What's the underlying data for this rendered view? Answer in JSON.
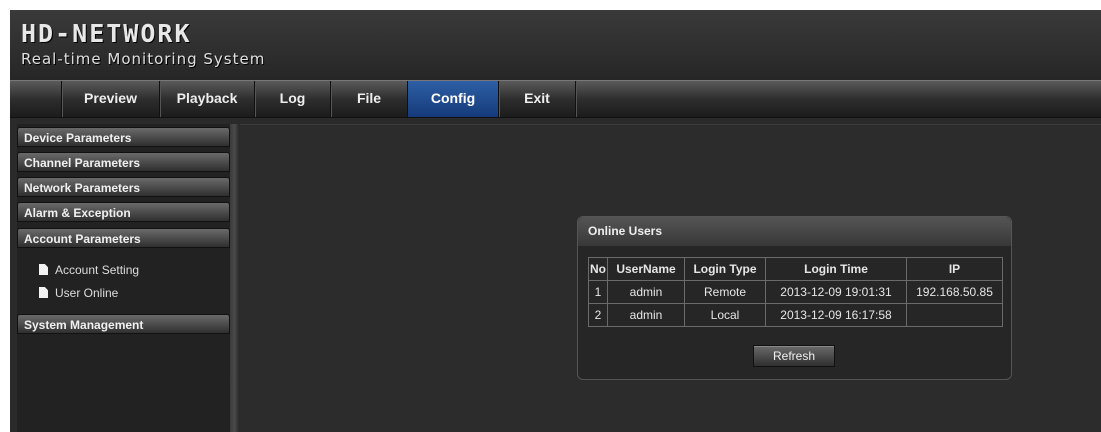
{
  "header": {
    "logo": "HD-NETWORK",
    "subtitle": "Real-time Monitoring System"
  },
  "nav": {
    "items": [
      {
        "label": "Preview"
      },
      {
        "label": "Playback"
      },
      {
        "label": "Log"
      },
      {
        "label": "File"
      },
      {
        "label": "Config",
        "active": true
      },
      {
        "label": "Exit"
      }
    ]
  },
  "sidebar": {
    "sections": [
      {
        "label": "Device Parameters"
      },
      {
        "label": "Channel Parameters"
      },
      {
        "label": "Network Parameters"
      },
      {
        "label": "Alarm & Exception"
      },
      {
        "label": "Account Parameters",
        "expanded": true
      },
      {
        "label": "System Management"
      }
    ],
    "sub_items": [
      {
        "label": "Account Setting",
        "icon": "document-icon"
      },
      {
        "label": "User Online",
        "icon": "document-icon"
      }
    ]
  },
  "online_users": {
    "title": "Online Users",
    "columns": [
      "No",
      "UserName",
      "Login Type",
      "Login Time",
      "IP"
    ],
    "rows": [
      [
        "1",
        "admin",
        "Remote",
        "2013-12-09 19:01:31",
        "192.168.50.85"
      ],
      [
        "2",
        "admin",
        "Local",
        "2013-12-09 16:17:58",
        ""
      ]
    ],
    "refresh_label": "Refresh"
  },
  "colors": {
    "accent": "#1f4e95",
    "background": "#2c2c2c"
  }
}
